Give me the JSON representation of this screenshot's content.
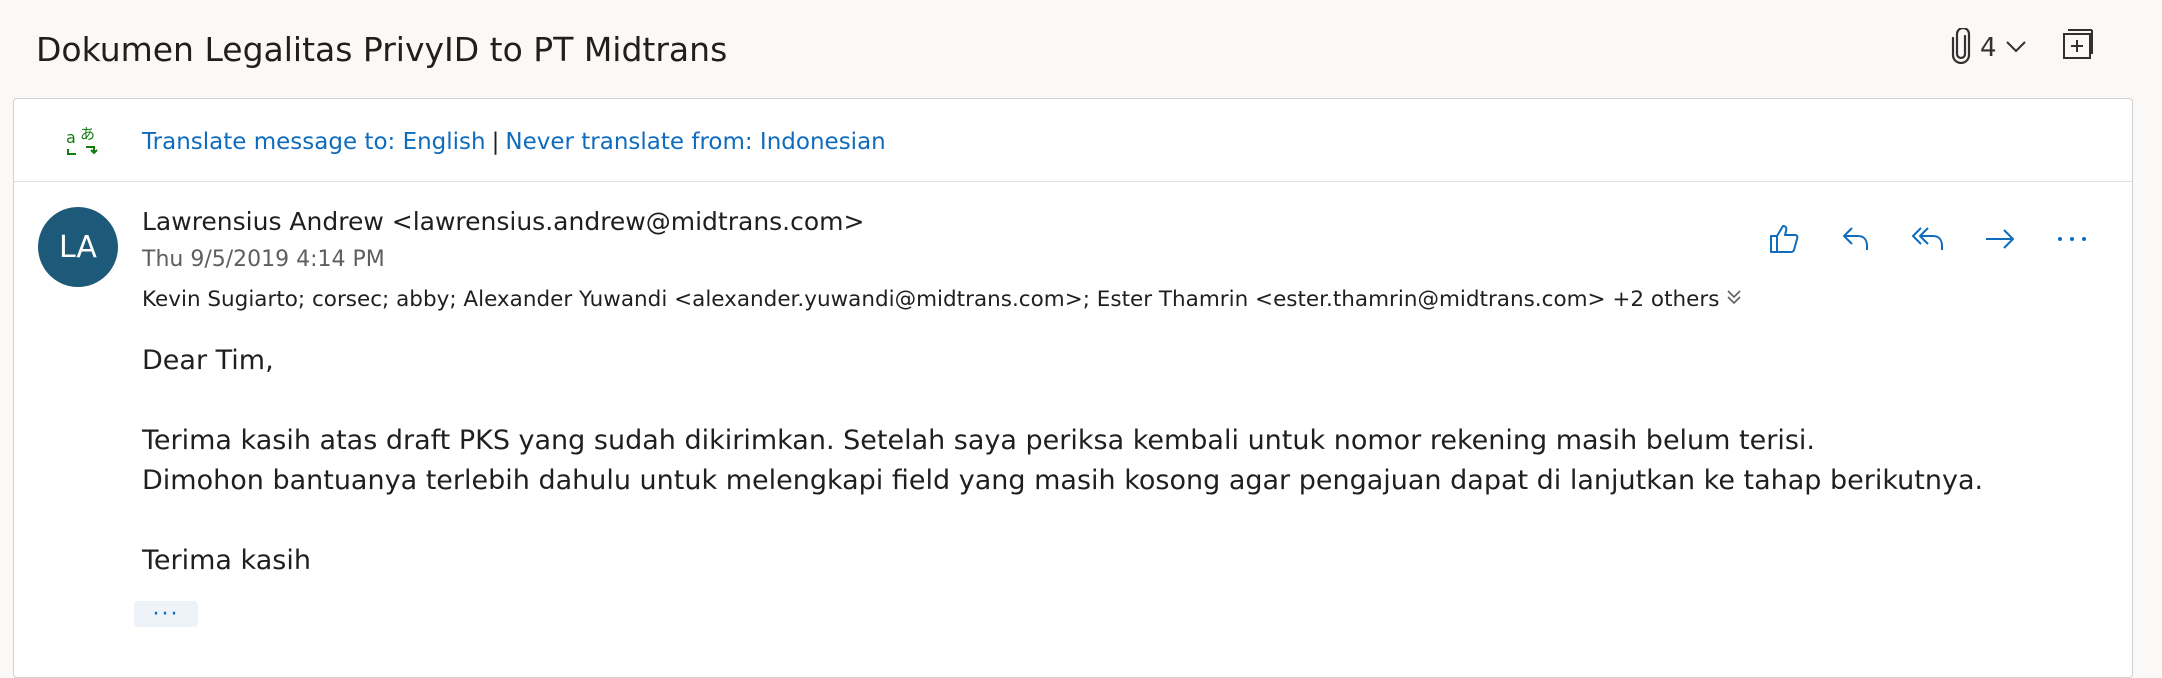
{
  "subject": "Dokumen Legalitas PrivyID to PT Midtrans",
  "attachments": {
    "count": "4"
  },
  "translate": {
    "translate_link": "Translate message to: English",
    "separator": "|",
    "never_link": "Never translate from: Indonesian"
  },
  "message": {
    "avatar_initials": "LA",
    "avatar_color": "#1d5a7a",
    "sender": "Lawrensius Andrew <lawrensius.andrew@midtrans.com>",
    "date": "Thu 9/5/2019 4:14 PM",
    "recipients": "Kevin Sugiarto; corsec; abby; Alexander Yuwandi <alexander.yuwandi@midtrans.com>; Ester Thamrin <ester.thamrin@midtrans.com> +2 others",
    "actions": [
      "like-icon",
      "reply-icon",
      "reply-all-icon",
      "forward-icon",
      "more-actions-icon"
    ],
    "body": {
      "greeting": "Dear Tim,",
      "line1": "Terima kasih atas draft PKS yang sudah dikirimkan. Setelah saya periksa kembali untuk nomor rekening masih belum terisi.",
      "line2": "Dimohon bantuanya terlebih dahulu untuk melengkapi field yang masih kosong agar pengajuan dapat di lanjutkan ke tahap berikutnya.",
      "closing": "Terima kasih"
    },
    "more_label": "···"
  },
  "colors": {
    "accent": "#0f6cbd",
    "translate_icon": "#107c10"
  }
}
